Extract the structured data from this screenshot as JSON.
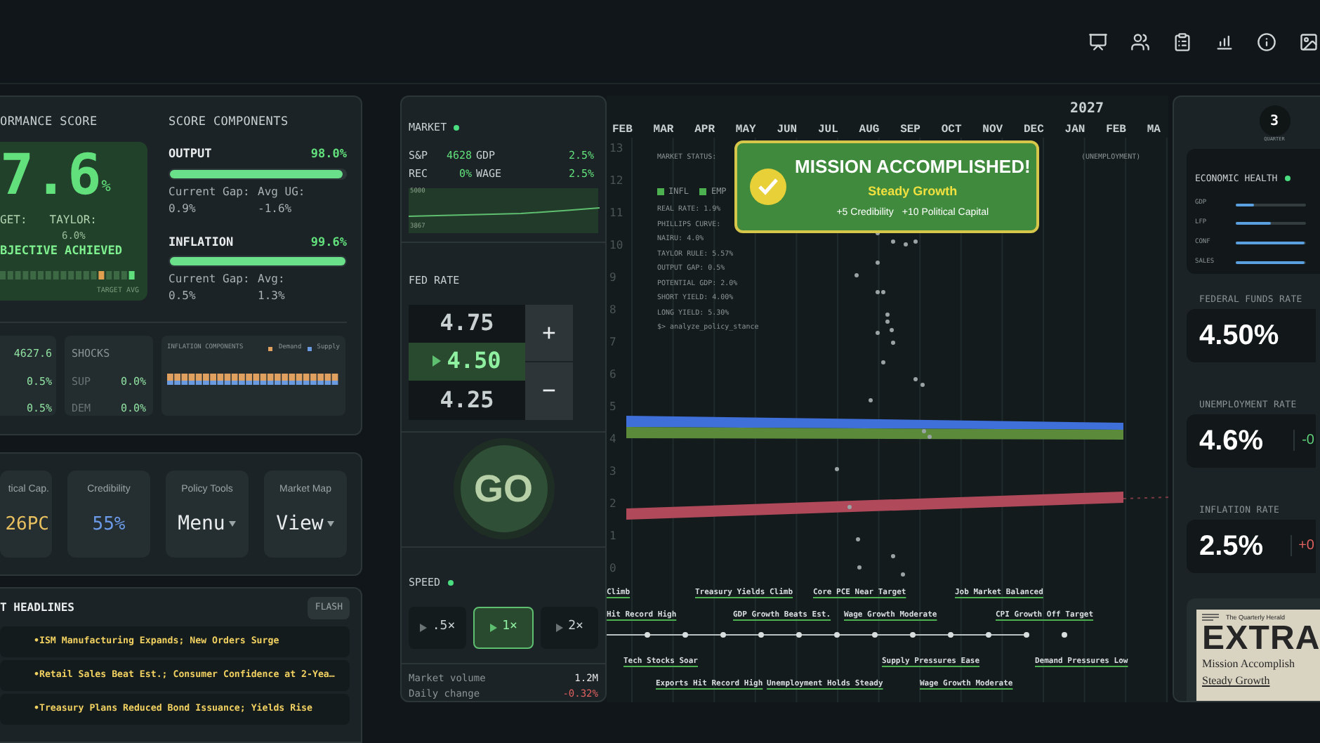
{
  "performance": {
    "title": "ORMANCE SCORE",
    "score": "7.6",
    "unit": "%",
    "target_label": "GET:",
    "taylor_label": "TAYLOR:",
    "taylor_value": "6.0%",
    "status": "BJECTIVE ACHIEVED",
    "bar_caption": "TARGET AVG"
  },
  "score_components": {
    "title": "SCORE COMPONENTS",
    "items": [
      {
        "name": "OUTPUT",
        "score": "98.0%",
        "level": 0.98,
        "stats": [
          {
            "label": "Current Gap:",
            "value": "0.9%"
          },
          {
            "label": "Avg UG:",
            "value": "-1.6%"
          }
        ]
      },
      {
        "name": "INFLATION",
        "score": "99.6%",
        "level": 0.996,
        "stats": [
          {
            "label": "Current Gap:",
            "value": "0.5%"
          },
          {
            "label": "Avg:",
            "value": "1.3%"
          }
        ]
      }
    ]
  },
  "stats": [
    "4627.6",
    "0.5%",
    "0.5%"
  ],
  "shocks": {
    "title": "SHOCKS",
    "rows": [
      {
        "label": "SUP",
        "value": "0.0%"
      },
      {
        "label": "DEM",
        "value": "0.0%"
      }
    ]
  },
  "inflation_components": {
    "title": "INFLATION COMPONENTS",
    "legend": [
      {
        "label": "Demand",
        "color": "#e0a060"
      },
      {
        "label": "Supply",
        "color": "#6a9ae0"
      }
    ]
  },
  "status_cards": [
    {
      "kind": "stat",
      "label": "tical Cap.",
      "value": "26PC",
      "color": "#e8c060"
    },
    {
      "kind": "stat",
      "label": "Credibility",
      "value": "55%",
      "color": "#6a9ae8"
    },
    {
      "kind": "menu",
      "label": "Policy Tools",
      "value": "Menu"
    },
    {
      "kind": "menu",
      "label": "Market Map",
      "value": "View"
    }
  ],
  "headlines": {
    "title": "T HEADLINES",
    "button": "FLASH",
    "items": [
      "•ISM Manufacturing Expands; New Orders Surge",
      "•Retail Sales Beat Est.; Consumer Confidence at 2-Yea…",
      "•Treasury Plans Reduced Bond Issuance; Yields Rise"
    ]
  },
  "market": {
    "title": "MARKET",
    "live": true,
    "stats": [
      {
        "label": "S&P",
        "value": "4628"
      },
      {
        "label": "GDP",
        "value": "2.5%"
      },
      {
        "label": "REC",
        "value": "0%"
      },
      {
        "label": "WAGE",
        "value": "2.5%"
      }
    ],
    "chart_labels": [
      "5000",
      "3867"
    ]
  },
  "fed_rate": {
    "title": "FED RATE",
    "options": [
      {
        "value": "4.75",
        "selected": false
      },
      {
        "value": "4.50",
        "selected": true
      },
      {
        "value": "4.25",
        "selected": false
      }
    ],
    "increase": "+",
    "decrease": "−"
  },
  "go_button": "GO",
  "speed": {
    "title": "SPEED",
    "live": true,
    "options": [
      {
        "label": ".5×",
        "selected": false
      },
      {
        "label": "1×",
        "selected": true
      },
      {
        "label": "2×",
        "selected": false
      }
    ]
  },
  "market_summary": [
    {
      "label": "Market volume",
      "value": "1.2M",
      "color": "#e6e6e6"
    },
    {
      "label": "Daily change",
      "value": "-0.32%",
      "color": "#e06060"
    }
  ],
  "timeline": {
    "year": "2027",
    "months": [
      "FEB",
      "MAR",
      "APR",
      "MAY",
      "JUN",
      "JUL",
      "AUG",
      "SEP",
      "OCT",
      "NOV",
      "DEC",
      "JAN",
      "FEB",
      "MA"
    ],
    "y_ticks": [
      "13",
      "12",
      "11",
      "10",
      "9",
      "8",
      "7",
      "6",
      "5",
      "4",
      "3",
      "2",
      "1",
      "0"
    ],
    "status_label": "MARKET STATUS:",
    "right_status": "(UNEMPLOYMENT)",
    "legend": [
      {
        "label": "INFL",
        "color": "#4caf50"
      },
      {
        "label": "EMP",
        "color": "#4caf50"
      }
    ],
    "console": [
      "REAL RATE: 1.9%",
      "PHILLIPS CURVE:",
      "NAIRU: 4.0%",
      "TAYLOR RULE: 5.57%",
      "OUTPUT GAP: 0.5%",
      "POTENTIAL GDP: 2.0%",
      "SHORT YIELD: 4.00%",
      "LONG YIELD: 5.30%",
      "$> analyze_policy_stance"
    ],
    "events": [
      {
        "label": "Climb"
      },
      {
        "label": "Treasury Yields Climb"
      },
      {
        "label": "Core PCE Near Target"
      },
      {
        "label": "Job Market Balanced"
      },
      {
        "label": "Hit Record High"
      },
      {
        "label": "GDP Growth Beats Est."
      },
      {
        "label": "Wage Growth Moderate"
      },
      {
        "label": "CPI Growth Off Target"
      },
      {
        "label": "Tech Stocks Soar"
      },
      {
        "label": "Supply Pressures Ease"
      },
      {
        "label": "Demand Pressures Low"
      },
      {
        "label": "Exports Hit Record High"
      },
      {
        "label": "Unemployment Holds Steady"
      },
      {
        "label": "Wage Growth Moderate"
      }
    ]
  },
  "alert": {
    "title": "MISSION ACCOMPLISHED!",
    "subtitle": "Steady Growth",
    "rewards": [
      "+5 Credibility",
      "+10 Political Capital"
    ]
  },
  "quarter": {
    "value": "3",
    "label": "QUARTER"
  },
  "economic_health": {
    "title": "ECONOMIC HEALTH",
    "live": true,
    "bars": [
      {
        "label": "GDP",
        "level": 0.25
      },
      {
        "label": "LFP",
        "level": 0.5
      },
      {
        "label": "CONF",
        "level": 0.97
      },
      {
        "label": "SALES",
        "level": 0.97
      }
    ]
  },
  "metrics": [
    {
      "title": "FEDERAL FUNDS RATE",
      "value": "4.50%"
    },
    {
      "title": "UNEMPLOYMENT RATE",
      "value": "4.6%",
      "change": "-0",
      "color": "#5fd07a"
    },
    {
      "title": "INFLATION RATE",
      "value": "2.5%",
      "change": "+0",
      "color": "#e06060"
    }
  ],
  "newspaper": {
    "masthead": "The Quarterly Herald",
    "banner": "EXTRA",
    "headline": "Mission Accomplish",
    "subhead": "Steady Growth"
  }
}
